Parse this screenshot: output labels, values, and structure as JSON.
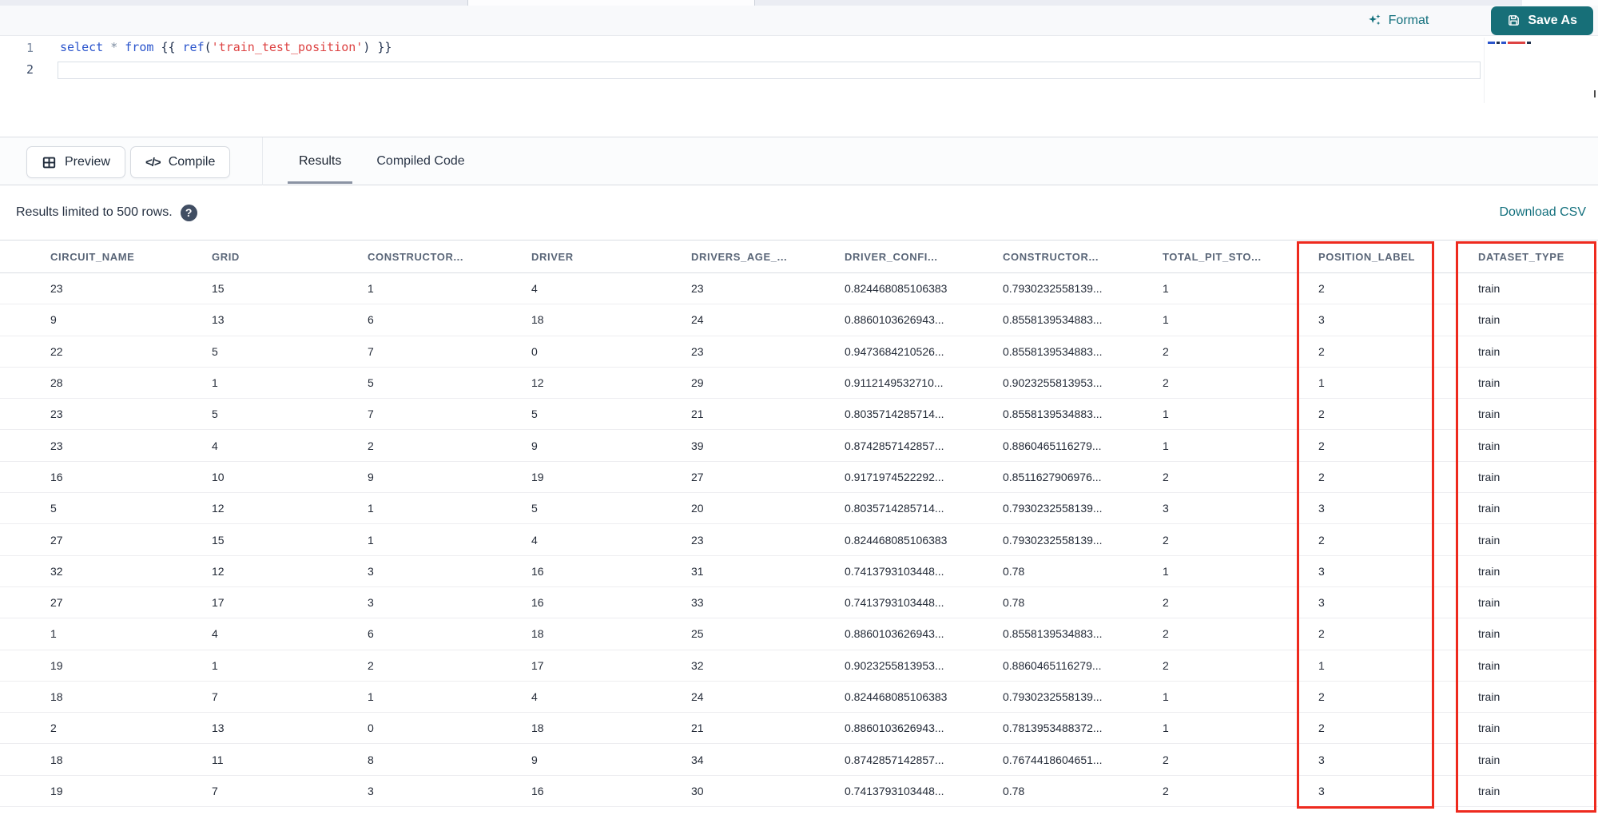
{
  "colors": {
    "accent_teal": "#13707d",
    "save_button_bg": "#176f78",
    "annotation_red": "#ee2a1e",
    "code_keyword_blue": "#2b55cc",
    "code_string_red": "#dd4343"
  },
  "editor": {
    "line_numbers": [
      "1",
      "2"
    ],
    "code_tokens": [
      {
        "text": "select",
        "type": "keyword"
      },
      {
        "text": " ",
        "type": "plain"
      },
      {
        "text": "*",
        "type": "operator"
      },
      {
        "text": " ",
        "type": "plain"
      },
      {
        "text": "from",
        "type": "keyword"
      },
      {
        "text": " ",
        "type": "plain"
      },
      {
        "text": "{{",
        "type": "punct"
      },
      {
        "text": " ",
        "type": "plain"
      },
      {
        "text": "ref",
        "type": "keyword"
      },
      {
        "text": "(",
        "type": "punct"
      },
      {
        "text": "'train_test_position'",
        "type": "string"
      },
      {
        "text": ")",
        "type": "punct"
      },
      {
        "text": " ",
        "type": "plain"
      },
      {
        "text": "}}",
        "type": "punct"
      }
    ],
    "format_label": "Format",
    "save_as_label": "Save As"
  },
  "actions": {
    "preview_label": "Preview",
    "compile_label": "Compile",
    "compile_glyph": "</>"
  },
  "tabs": [
    {
      "label": "Results",
      "active": true
    },
    {
      "label": "Compiled Code",
      "active": false
    }
  ],
  "results_bar": {
    "info_text": "Results limited to 500 rows.",
    "help_glyph": "?",
    "download_label": "Download CSV"
  },
  "table": {
    "columns": [
      "CIRCUIT_NAME",
      "GRID",
      "CONSTRUCTOR...",
      "DRIVER",
      "DRIVERS_AGE_...",
      "DRIVER_CONFI...",
      "CONSTRUCTOR...",
      "TOTAL_PIT_STO...",
      "POSITION_LABEL",
      "DATASET_TYPE"
    ],
    "highlighted_columns": [
      "POSITION_LABEL",
      "DATASET_TYPE"
    ],
    "rows": [
      [
        "23",
        "15",
        "1",
        "4",
        "23",
        "0.824468085106383",
        "0.7930232558139...",
        "1",
        "2",
        "train"
      ],
      [
        "9",
        "13",
        "6",
        "18",
        "24",
        "0.8860103626943...",
        "0.8558139534883...",
        "1",
        "3",
        "train"
      ],
      [
        "22",
        "5",
        "7",
        "0",
        "23",
        "0.9473684210526...",
        "0.8558139534883...",
        "2",
        "2",
        "train"
      ],
      [
        "28",
        "1",
        "5",
        "12",
        "29",
        "0.9112149532710...",
        "0.9023255813953...",
        "2",
        "1",
        "train"
      ],
      [
        "23",
        "5",
        "7",
        "5",
        "21",
        "0.8035714285714...",
        "0.8558139534883...",
        "1",
        "2",
        "train"
      ],
      [
        "23",
        "4",
        "2",
        "9",
        "39",
        "0.8742857142857...",
        "0.8860465116279...",
        "1",
        "2",
        "train"
      ],
      [
        "16",
        "10",
        "9",
        "19",
        "27",
        "0.9171974522292...",
        "0.8511627906976...",
        "2",
        "2",
        "train"
      ],
      [
        "5",
        "12",
        "1",
        "5",
        "20",
        "0.8035714285714...",
        "0.7930232558139...",
        "3",
        "3",
        "train"
      ],
      [
        "27",
        "15",
        "1",
        "4",
        "23",
        "0.824468085106383",
        "0.7930232558139...",
        "2",
        "2",
        "train"
      ],
      [
        "32",
        "12",
        "3",
        "16",
        "31",
        "0.7413793103448...",
        "0.78",
        "1",
        "3",
        "train"
      ],
      [
        "27",
        "17",
        "3",
        "16",
        "33",
        "0.7413793103448...",
        "0.78",
        "2",
        "3",
        "train"
      ],
      [
        "1",
        "4",
        "6",
        "18",
        "25",
        "0.8860103626943...",
        "0.8558139534883...",
        "2",
        "2",
        "train"
      ],
      [
        "19",
        "1",
        "2",
        "17",
        "32",
        "0.9023255813953...",
        "0.8860465116279...",
        "2",
        "1",
        "train"
      ],
      [
        "18",
        "7",
        "1",
        "4",
        "24",
        "0.824468085106383",
        "0.7930232558139...",
        "1",
        "2",
        "train"
      ],
      [
        "2",
        "13",
        "0",
        "18",
        "21",
        "0.8860103626943...",
        "0.7813953488372...",
        "1",
        "2",
        "train"
      ],
      [
        "18",
        "11",
        "8",
        "9",
        "34",
        "0.8742857142857...",
        "0.7674418604651...",
        "2",
        "3",
        "train"
      ],
      [
        "19",
        "7",
        "3",
        "16",
        "30",
        "0.7413793103448...",
        "0.78",
        "2",
        "3",
        "train"
      ]
    ]
  }
}
